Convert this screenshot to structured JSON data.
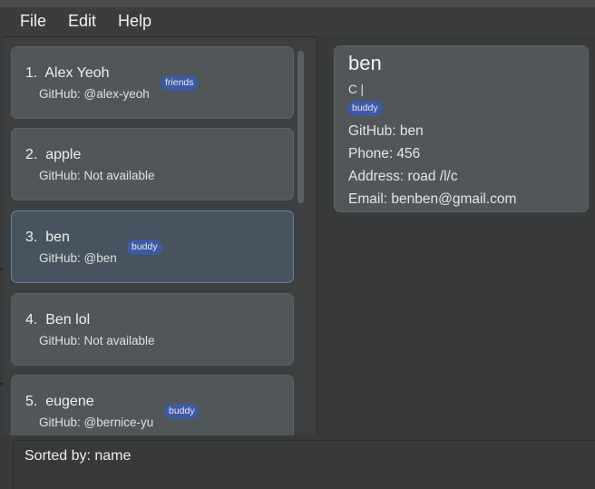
{
  "menu": {
    "file": "File",
    "edit": "Edit",
    "help": "Help"
  },
  "persons": [
    {
      "index": "1.",
      "name": "Alex Yeoh",
      "github": "GitHub: @alex-yeoh",
      "tag": "friends"
    },
    {
      "index": "2.",
      "name": "apple",
      "github": "GitHub: Not available",
      "tag": ""
    },
    {
      "index": "3.",
      "name": "ben",
      "github": "GitHub: @ben",
      "tag": "buddy"
    },
    {
      "index": "4.",
      "name": "Ben lol",
      "github": "GitHub: Not available",
      "tag": ""
    },
    {
      "index": "5.",
      "name": "eugene",
      "github": "GitHub: @bernice-yu",
      "tag": "buddy"
    }
  ],
  "detail": {
    "name": "ben",
    "remark": "C |",
    "tag": "buddy",
    "github": "GitHub:  ben",
    "phone": "Phone: 456",
    "address": "Address: road /l/c",
    "email": "Email: benben@gmail.com"
  },
  "result": {
    "text": "Sorted by: name"
  },
  "colors": {
    "background": "#393a3b",
    "card": "#515658",
    "selected_card": "#47535e",
    "selected_border": "#5b87ad",
    "tag": "#3e5aa3"
  }
}
